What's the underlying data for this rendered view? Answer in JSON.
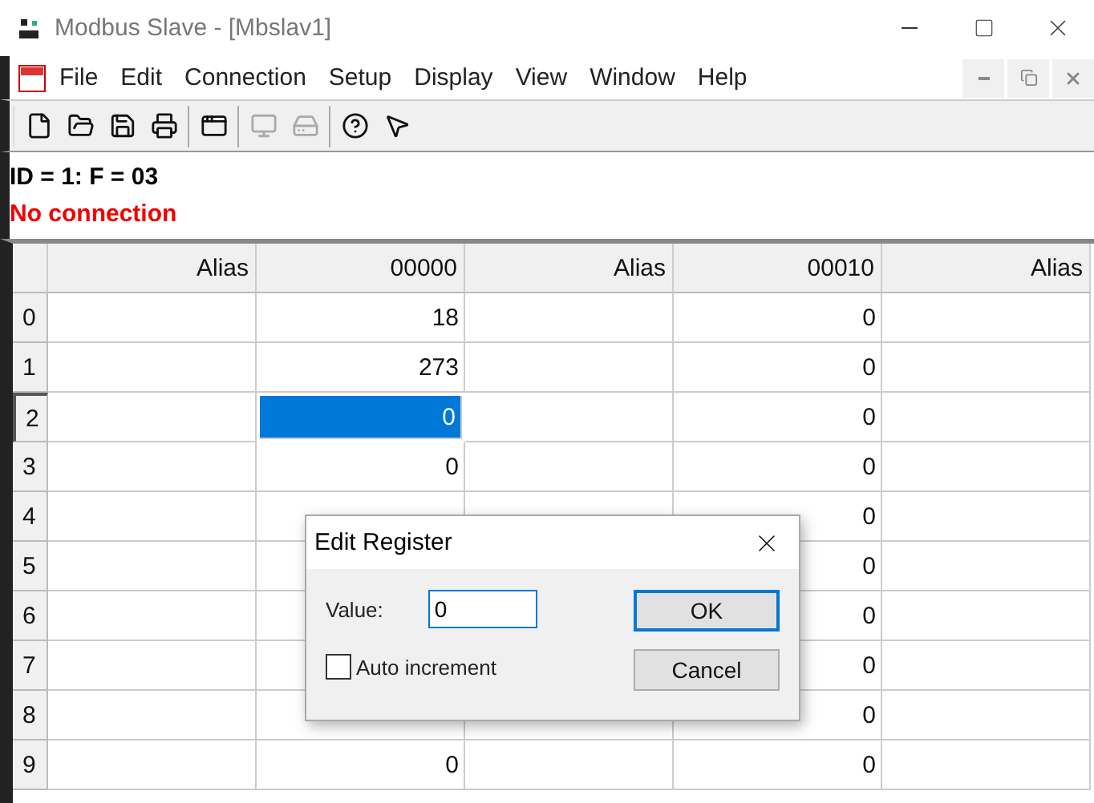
{
  "window": {
    "title": "Modbus Slave - [Mbslav1]"
  },
  "menu": [
    "File",
    "Edit",
    "Connection",
    "Setup",
    "Display",
    "View",
    "Window",
    "Help"
  ],
  "toolbar": [
    [
      {
        "disabled": false
      },
      {
        "disabled": false
      },
      {
        "disabled": false
      },
      {
        "disabled": false
      }
    ],
    [
      {
        "disabled": false
      }
    ],
    [
      {
        "disabled": true
      },
      {
        "disabled": true
      }
    ],
    [
      {
        "disabled": false
      },
      {
        "disabled": false
      }
    ]
  ],
  "info": {
    "id_line": "ID = 1: F = 03",
    "status": "No connection"
  },
  "table": {
    "columns": [
      "Alias",
      "00000",
      "Alias",
      "00010",
      "Alias"
    ],
    "rows": [
      {
        "header": "0",
        "cells": [
          {
            "selected": false
          },
          {
            "value": "18",
            "selected": false
          },
          {
            "selected": false
          },
          {
            "value": "0",
            "selected": false
          },
          {
            "selected": false
          }
        ]
      },
      {
        "header": "1",
        "cells": [
          {
            "selected": false
          },
          {
            "value": "273",
            "selected": false
          },
          {
            "selected": false
          },
          {
            "value": "0",
            "selected": false
          },
          {
            "selected": false
          }
        ]
      },
      {
        "header": "2",
        "cells": [
          {
            "selected": false
          },
          {
            "value": "0",
            "selected": true
          },
          {
            "selected": false
          },
          {
            "value": "0",
            "selected": false
          },
          {
            "selected": false
          }
        ]
      },
      {
        "header": "3",
        "cells": [
          {
            "selected": false
          },
          {
            "value": "0",
            "selected": false
          },
          {
            "selected": false
          },
          {
            "value": "0",
            "selected": false
          },
          {
            "selected": false
          }
        ]
      },
      {
        "header": "4",
        "cells": [
          {
            "selected": false
          },
          {
            "selected": false
          },
          {
            "selected": false
          },
          {
            "value": "0",
            "selected": false
          },
          {
            "selected": false
          }
        ]
      },
      {
        "header": "5",
        "cells": [
          {
            "selected": false
          },
          {
            "selected": false
          },
          null,
          {
            "value": "0",
            "selected": false
          },
          {
            "selected": false
          }
        ]
      },
      {
        "header": "6",
        "cells": [
          {
            "selected": false
          },
          {
            "selected": false
          },
          null,
          {
            "value": "0",
            "selected": false
          },
          {
            "selected": false
          }
        ]
      },
      {
        "header": "7",
        "cells": [
          {
            "selected": false
          },
          {
            "selected": false
          },
          null,
          {
            "value": "0",
            "selected": false
          },
          {
            "selected": false
          }
        ]
      },
      {
        "header": "8",
        "cells": [
          {
            "selected": false
          },
          {
            "selected": false
          },
          {
            "selected": false
          },
          {
            "value": "0",
            "selected": false
          },
          {
            "selected": false
          }
        ]
      },
      {
        "header": "9",
        "cells": [
          {
            "selected": false
          },
          {
            "value": "0",
            "selected": false
          },
          {
            "selected": false
          },
          {
            "value": "0",
            "selected": false
          },
          {
            "selected": false
          }
        ]
      }
    ]
  },
  "dialog": {
    "title": "Edit Register",
    "value_label": "Value:",
    "value": "0",
    "auto_increment": {
      "label": "Auto increment",
      "checked": false
    },
    "buttons": [
      "OK",
      "Cancel"
    ]
  }
}
